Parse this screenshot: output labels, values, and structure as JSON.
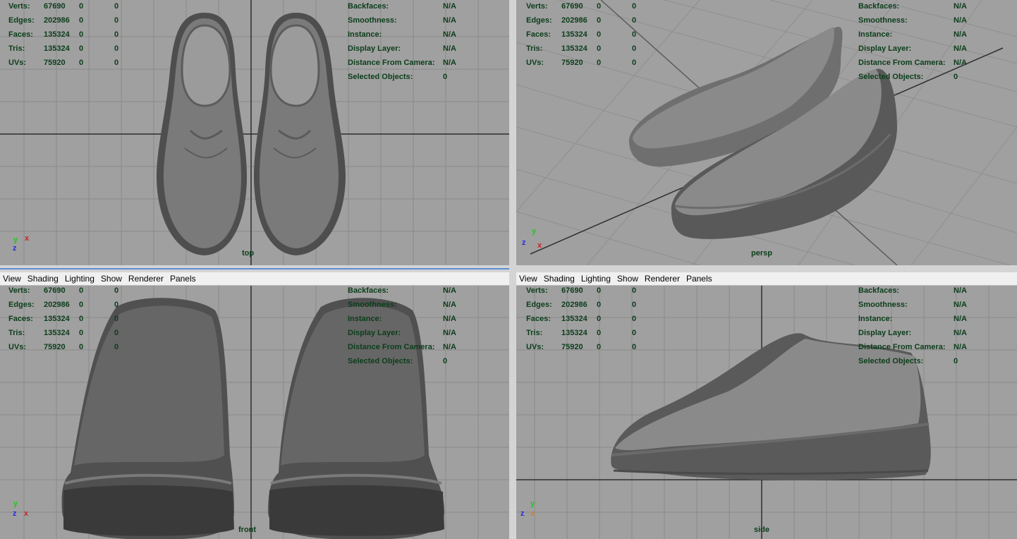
{
  "panels": [
    {
      "id": "top",
      "camera": "top",
      "has_menu": false,
      "stats": [
        {
          "label": "Verts:",
          "v1": "67690",
          "v2": "0",
          "v3": "0"
        },
        {
          "label": "Edges:",
          "v1": "202986",
          "v2": "0",
          "v3": "0"
        },
        {
          "label": "Faces:",
          "v1": "135324",
          "v2": "0",
          "v3": "0"
        },
        {
          "label": "Tris:",
          "v1": "135324",
          "v2": "0",
          "v3": "0"
        },
        {
          "label": "UVs:",
          "v1": "75920",
          "v2": "0",
          "v3": "0"
        }
      ],
      "info": [
        {
          "label": "Backfaces:",
          "value": "N/A"
        },
        {
          "label": "Smoothness:",
          "value": "N/A"
        },
        {
          "label": "Instance:",
          "value": "N/A"
        },
        {
          "label": "Display Layer:",
          "value": "N/A"
        },
        {
          "label": "Distance From Camera:",
          "value": "N/A"
        },
        {
          "label": "Selected Objects:",
          "value": "0"
        }
      ],
      "axes": {
        "a": "y",
        "b": "x",
        "c": "z"
      }
    },
    {
      "id": "persp",
      "camera": "persp",
      "has_menu": false,
      "stats": [
        {
          "label": "Verts:",
          "v1": "67690",
          "v2": "0",
          "v3": "0"
        },
        {
          "label": "Edges:",
          "v1": "202986",
          "v2": "0",
          "v3": "0"
        },
        {
          "label": "Faces:",
          "v1": "135324",
          "v2": "0",
          "v3": "0"
        },
        {
          "label": "Tris:",
          "v1": "135324",
          "v2": "0",
          "v3": "0"
        },
        {
          "label": "UVs:",
          "v1": "75920",
          "v2": "0",
          "v3": "0"
        }
      ],
      "info": [
        {
          "label": "Backfaces:",
          "value": "N/A"
        },
        {
          "label": "Smoothness:",
          "value": "N/A"
        },
        {
          "label": "Instance:",
          "value": "N/A"
        },
        {
          "label": "Display Layer:",
          "value": "N/A"
        },
        {
          "label": "Distance From Camera:",
          "value": "N/A"
        },
        {
          "label": "Selected Objects:",
          "value": "0"
        }
      ],
      "axes": {
        "a": "y",
        "b": "x",
        "c": "z"
      }
    },
    {
      "id": "front",
      "camera": "front",
      "has_menu": true,
      "stats": [
        {
          "label": "Verts:",
          "v1": "67690",
          "v2": "0",
          "v3": "0"
        },
        {
          "label": "Edges:",
          "v1": "202986",
          "v2": "0",
          "v3": "0"
        },
        {
          "label": "Faces:",
          "v1": "135324",
          "v2": "0",
          "v3": "0"
        },
        {
          "label": "Tris:",
          "v1": "135324",
          "v2": "0",
          "v3": "0"
        },
        {
          "label": "UVs:",
          "v1": "75920",
          "v2": "0",
          "v3": "0"
        }
      ],
      "info": [
        {
          "label": "Backfaces:",
          "value": "N/A"
        },
        {
          "label": "Smoothness:",
          "value": "N/A"
        },
        {
          "label": "Instance:",
          "value": "N/A"
        },
        {
          "label": "Display Layer:",
          "value": "N/A"
        },
        {
          "label": "Distance From Camera:",
          "value": "N/A"
        },
        {
          "label": "Selected Objects:",
          "value": "0"
        }
      ],
      "axes": {
        "a": "y",
        "b": "x",
        "c": "z"
      }
    },
    {
      "id": "side",
      "camera": "side",
      "has_menu": true,
      "stats": [
        {
          "label": "Verts:",
          "v1": "67690",
          "v2": "0",
          "v3": "0"
        },
        {
          "label": "Edges:",
          "v1": "202986",
          "v2": "0",
          "v3": "0"
        },
        {
          "label": "Faces:",
          "v1": "135324",
          "v2": "0",
          "v3": "0"
        },
        {
          "label": "Tris:",
          "v1": "135324",
          "v2": "0",
          "v3": "0"
        },
        {
          "label": "UVs:",
          "v1": "75920",
          "v2": "0",
          "v3": "0"
        }
      ],
      "info": [
        {
          "label": "Backfaces:",
          "value": "N/A"
        },
        {
          "label": "Smoothness:",
          "value": "N/A"
        },
        {
          "label": "Instance:",
          "value": "N/A"
        },
        {
          "label": "Display Layer:",
          "value": "N/A"
        },
        {
          "label": "Distance From Camera:",
          "value": "N/A"
        },
        {
          "label": "Selected Objects:",
          "value": "0"
        }
      ],
      "axes": {
        "a": "y",
        "b": "x",
        "c": "z"
      }
    }
  ],
  "menu": [
    "View",
    "Shading",
    "Lighting",
    "Show",
    "Renderer",
    "Panels"
  ],
  "colors": {
    "viewport_bg": "#a0a0a0",
    "grid": "#8a8a8a",
    "axis_line": "#2e2e2e",
    "hud_text": "#0b3d1a",
    "axis_y": "#22c522",
    "axis_x": "#d22020",
    "axis_z": "#2a2adf",
    "active_border": "#5b8fd6"
  }
}
